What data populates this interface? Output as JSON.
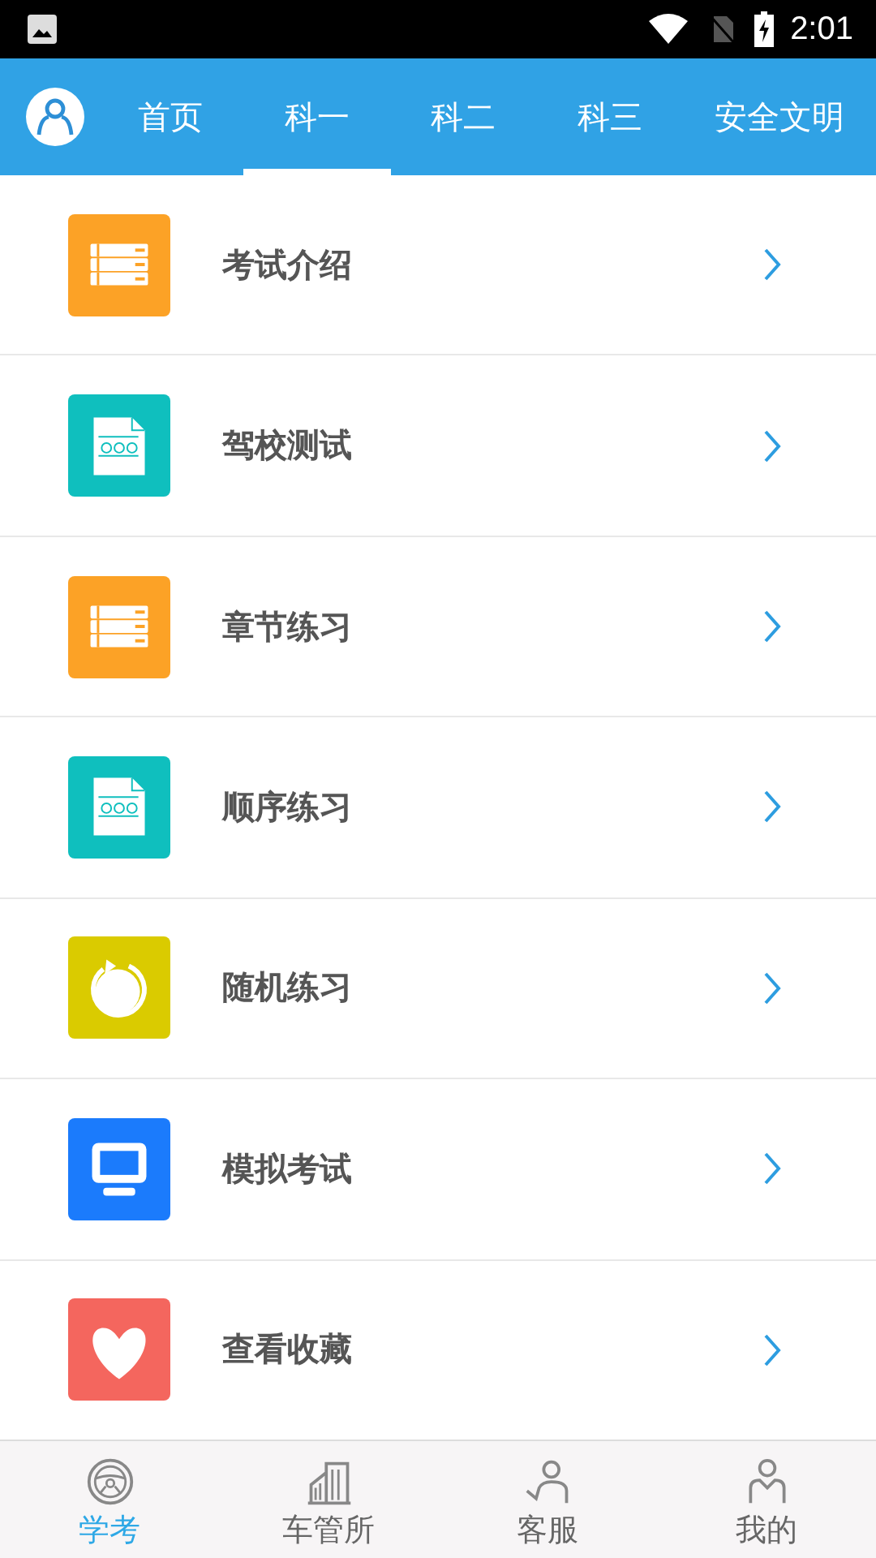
{
  "status_bar": {
    "time": "2:01"
  },
  "tabs": [
    {
      "label": "首页",
      "selected": false
    },
    {
      "label": "科一",
      "selected": true
    },
    {
      "label": "科二",
      "selected": false
    },
    {
      "label": "科三",
      "selected": false
    },
    {
      "label": "安全文明",
      "selected": false
    }
  ],
  "menu": [
    {
      "label": "考试介绍",
      "kind": "list",
      "color": "#fca226"
    },
    {
      "label": "驾校测试",
      "kind": "doc",
      "color": "#0fbfbe"
    },
    {
      "label": "章节练习",
      "kind": "list",
      "color": "#fca226"
    },
    {
      "label": "顺序练习",
      "kind": "doc",
      "color": "#0fbfbe"
    },
    {
      "label": "随机练习",
      "kind": "refresh",
      "color": "#dacb00"
    },
    {
      "label": "模拟考试",
      "kind": "monitor",
      "color": "#1b7bfc"
    },
    {
      "label": "查看收藏",
      "kind": "heart",
      "color": "#f4665e"
    }
  ],
  "bottom_nav": [
    {
      "label": "学考",
      "kind": "wheel",
      "selected": true
    },
    {
      "label": "车管所",
      "kind": "building",
      "selected": false
    },
    {
      "label": "客服",
      "kind": "service",
      "selected": false
    },
    {
      "label": "我的",
      "kind": "person",
      "selected": false
    }
  ]
}
